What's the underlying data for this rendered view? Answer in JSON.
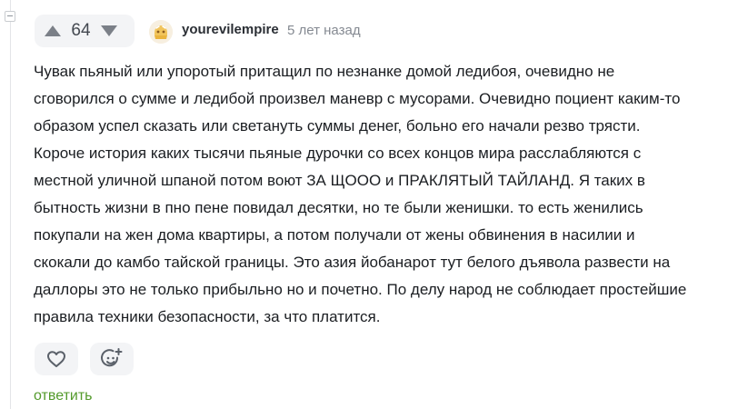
{
  "colors": {
    "vote_background": "#f3f4f6",
    "arrow": "#7b8088",
    "reply_link": "#539a2b",
    "timestamp": "#858a92"
  },
  "vote": {
    "count": "64",
    "up_icon": "arrow-up-icon",
    "down_icon": "arrow-down-icon"
  },
  "author": {
    "username": "yourevilempire",
    "time": "5 лет назад",
    "avatar_icon": "avatar-icon"
  },
  "comment": {
    "text": "Чувак пьяный или упоротый притащил по незнанке домой ледибоя, очевидно не\nсговорился о сумме и ледибой произвел маневр с мусорами. Очевидно поциент каким-то\nобразом успел сказать или светануть суммы денег, больно его начали резво трясти.\nКороче история каких тысячи пьяные дурочки со всех концов мира расслабляются с\nместной уличной шпаной потом воют ЗА ЩООО и ПРАКЛЯТЫЙ ТАЙЛАНД. Я таких в\nбытность жизни в пно пене повидал десятки, но те были женишки. то есть женились\nпокупали на жен дома квартиры, а потом получали от жены обвинения в насилии и\nскокали до камбо тайской границы. Это азия йобанарот тут белого дъявола развести на\nдаллоры это не только прибыльно но и почетно. По делу народ не соблюдает простейшие\nправила техники безопасности, за что платится."
  },
  "actions": {
    "like_icon": "heart-icon",
    "reaction_icon": "add-reaction-icon",
    "reply_label": "ответить"
  }
}
